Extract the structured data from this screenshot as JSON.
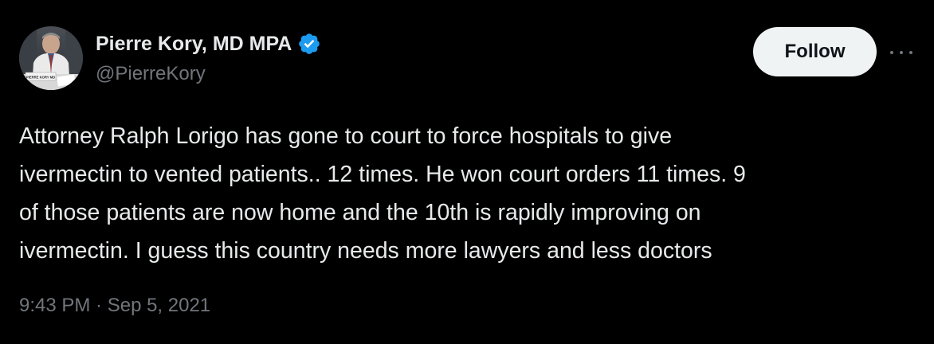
{
  "author": {
    "display_name": "Pierre Kory, MD MPA",
    "handle": "@PierreKory",
    "verified": true,
    "avatar_placard": "PIERRE KORY MD"
  },
  "actions": {
    "follow_label": "Follow",
    "more_icon": "more-horizontal-icon"
  },
  "tweet": {
    "lines": [
      "Attorney Ralph Lorigo has gone to court to force hospitals to give",
      "ivermectin to vented patients.. 12 times. He won court orders 11 times. 9",
      "of those patients are now home and the 10th is rapidly improving on",
      "ivermectin. I guess this country needs more lawyers and less doctors"
    ],
    "timestamp": "9:43 PM · Sep 5, 2021"
  },
  "colors": {
    "background": "#000000",
    "primary_text": "#e7e9ea",
    "secondary_text": "#71767b",
    "verified_badge": "#1d9bf0",
    "follow_button_bg": "#eff3f4",
    "follow_button_text": "#0f1419"
  }
}
